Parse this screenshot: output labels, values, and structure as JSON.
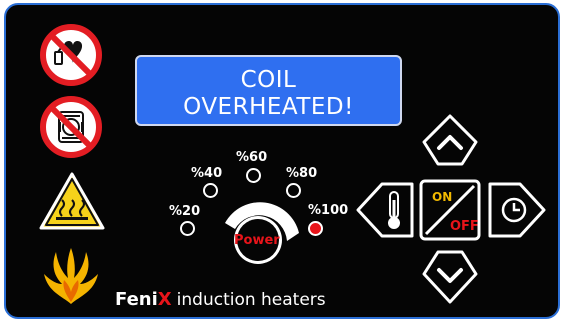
{
  "display": {
    "line1": "COIL",
    "line2": "OVERHEATED!"
  },
  "power_knob": {
    "label": "Power",
    "levels": [
      "%20",
      "%40",
      "%60",
      "%80",
      "%100"
    ],
    "active_level": "%100"
  },
  "controls": {
    "on_label": "ON",
    "off_label": "OFF"
  },
  "brand": {
    "name_part1": "Feni",
    "name_part2": "X",
    "tagline": "induction heaters"
  },
  "colors": {
    "panel": "#050505",
    "border": "#2b6fd6",
    "display": "#2f6ff0",
    "on": "#f2b900",
    "off": "#e8141a",
    "warning": "#f6d21a"
  },
  "icons": [
    "no-pacemaker-icon",
    "no-metal-implant-icon",
    "hot-surface-warning-icon",
    "phoenix-logo-icon",
    "thermometer-icon",
    "timer-icon",
    "arrow-up-icon",
    "arrow-down-icon"
  ]
}
